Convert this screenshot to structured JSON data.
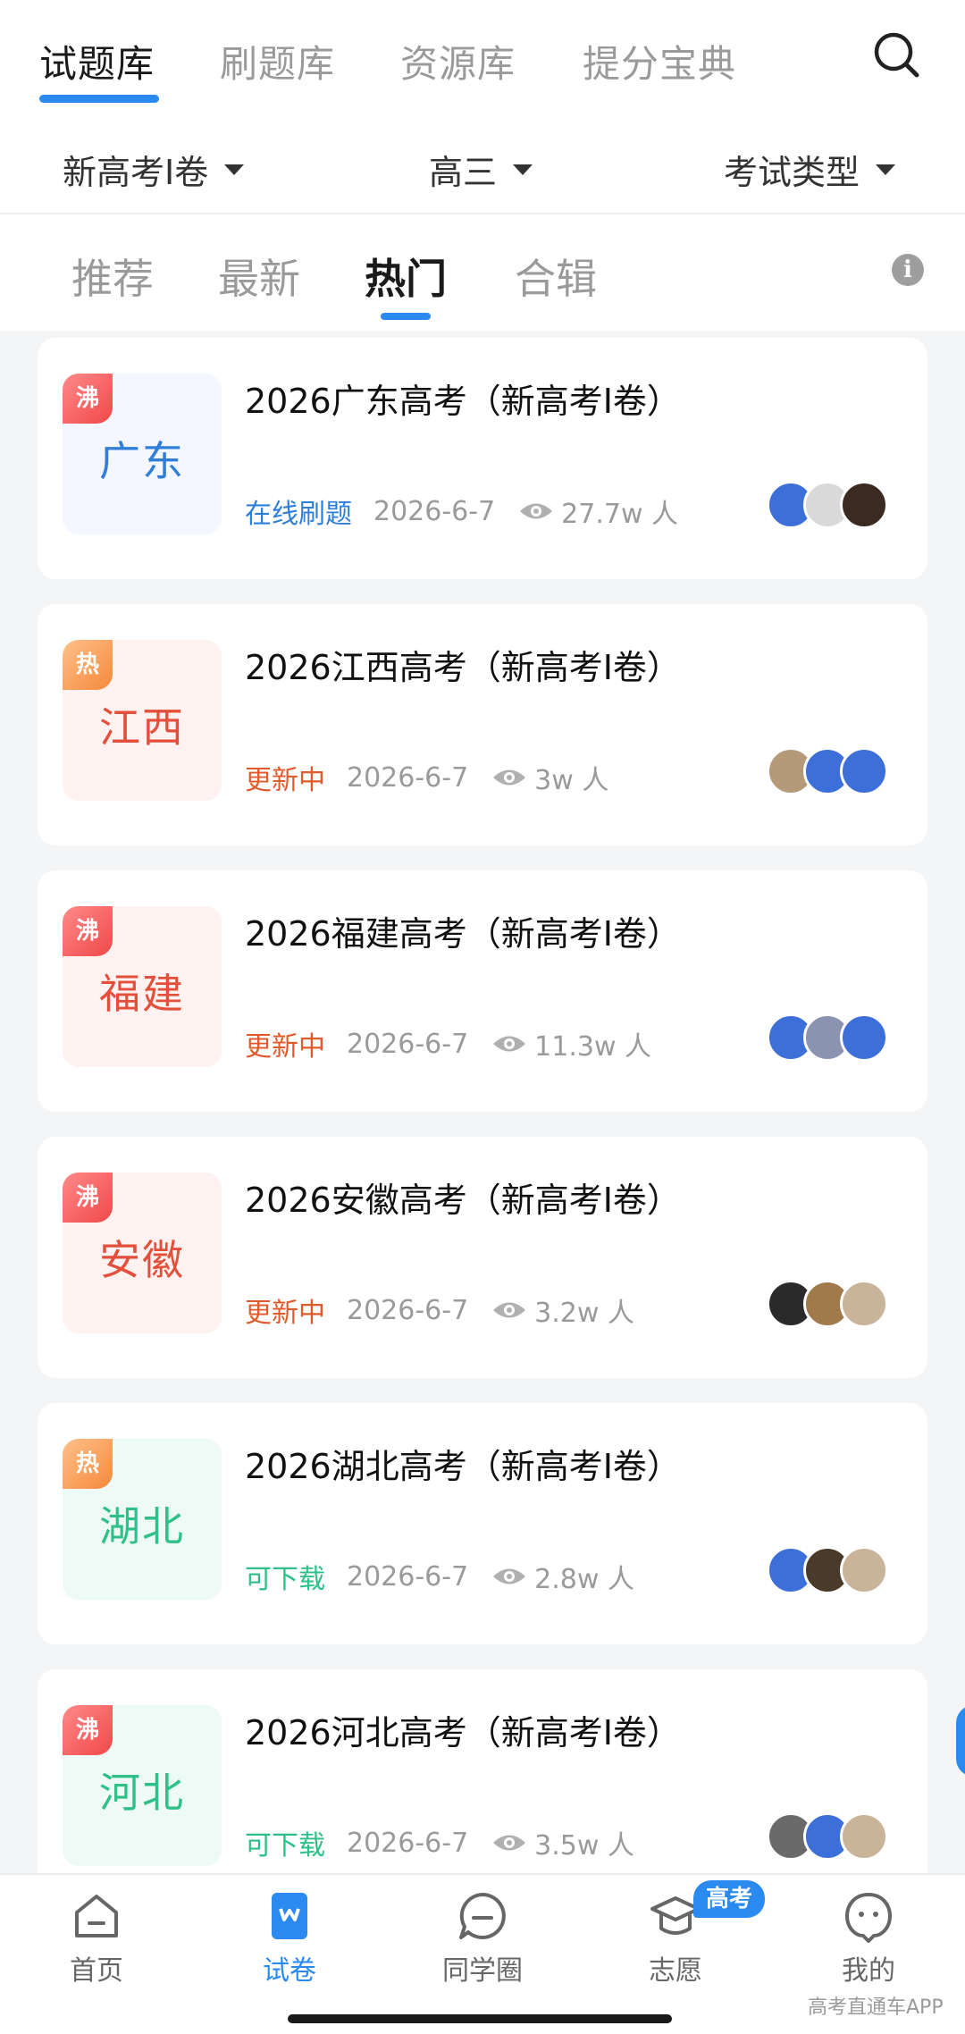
{
  "main_tabs": [
    {
      "label": "试题库",
      "active": true
    },
    {
      "label": "刷题库",
      "active": false
    },
    {
      "label": "资源库",
      "active": false
    },
    {
      "label": "提分宝典",
      "active": false
    }
  ],
  "filters": [
    {
      "label": "新高考Ⅰ卷"
    },
    {
      "label": "高三"
    },
    {
      "label": "考试类型"
    }
  ],
  "sub_tabs": [
    {
      "label": "推荐",
      "active": false
    },
    {
      "label": "最新",
      "active": false
    },
    {
      "label": "热门",
      "active": true
    },
    {
      "label": "合辑",
      "active": false
    }
  ],
  "info_icon_glyph": "i",
  "cards": [
    {
      "tag": "沸",
      "tag_kind": "boil",
      "province": "广东",
      "theme": "blue",
      "title": "2026广东高考（新高考Ⅰ卷）",
      "status": "在线刷题",
      "date": "2026-6-7",
      "views": "27.7w 人",
      "avatar_colors": [
        "#3d6fd8",
        "#d9d9d9",
        "#3a2a22"
      ]
    },
    {
      "tag": "热",
      "tag_kind": "hot",
      "province": "江西",
      "theme": "red",
      "title": "2026江西高考（新高考Ⅰ卷）",
      "status": "更新中",
      "date": "2026-6-7",
      "views": "3w 人",
      "avatar_colors": [
        "#b49a78",
        "#3d6fd8",
        "#3d6fd8"
      ]
    },
    {
      "tag": "沸",
      "tag_kind": "boil",
      "province": "福建",
      "theme": "red",
      "title": "2026福建高考（新高考Ⅰ卷）",
      "status": "更新中",
      "date": "2026-6-7",
      "views": "11.3w 人",
      "avatar_colors": [
        "#3d6fd8",
        "#8a93b0",
        "#3d6fd8"
      ]
    },
    {
      "tag": "沸",
      "tag_kind": "boil",
      "province": "安徽",
      "theme": "red",
      "title": "2026安徽高考（新高考Ⅰ卷）",
      "status": "更新中",
      "date": "2026-6-7",
      "views": "3.2w 人",
      "avatar_colors": [
        "#2a2a2a",
        "#a07a4a",
        "#c9b49a"
      ]
    },
    {
      "tag": "热",
      "tag_kind": "hot",
      "province": "湖北",
      "theme": "green",
      "title": "2026湖北高考（新高考Ⅰ卷）",
      "status": "可下载",
      "date": "2026-6-7",
      "views": "2.8w 人",
      "avatar_colors": [
        "#3d6fd8",
        "#4a3a2a",
        "#c9b49a"
      ]
    },
    {
      "tag": "沸",
      "tag_kind": "boil",
      "province": "河北",
      "theme": "green",
      "title": "2026河北高考（新高考Ⅰ卷）",
      "status": "可下载",
      "date": "2026-6-7",
      "views": "3.5w 人",
      "avatar_colors": [
        "#6a6a6a",
        "#3d6fd8",
        "#c9b49a"
      ]
    }
  ],
  "bottom_nav": [
    {
      "label": "首页",
      "icon": "home-icon",
      "active": false
    },
    {
      "label": "试卷",
      "icon": "paper-icon",
      "active": true
    },
    {
      "label": "同学圈",
      "icon": "chat-icon",
      "active": false
    },
    {
      "label": "志愿",
      "icon": "graduation-cap-icon",
      "active": false
    },
    {
      "label": "我的",
      "icon": "profile-icon",
      "active": false
    }
  ],
  "nav_badge": "高考",
  "watermark": "高考直通车APP",
  "colors": {
    "accent": "#2b8af0",
    "blue": "#2f7ed8",
    "red": "#e34f3a",
    "orange": "#e05a2b",
    "green": "#2fc08a"
  }
}
